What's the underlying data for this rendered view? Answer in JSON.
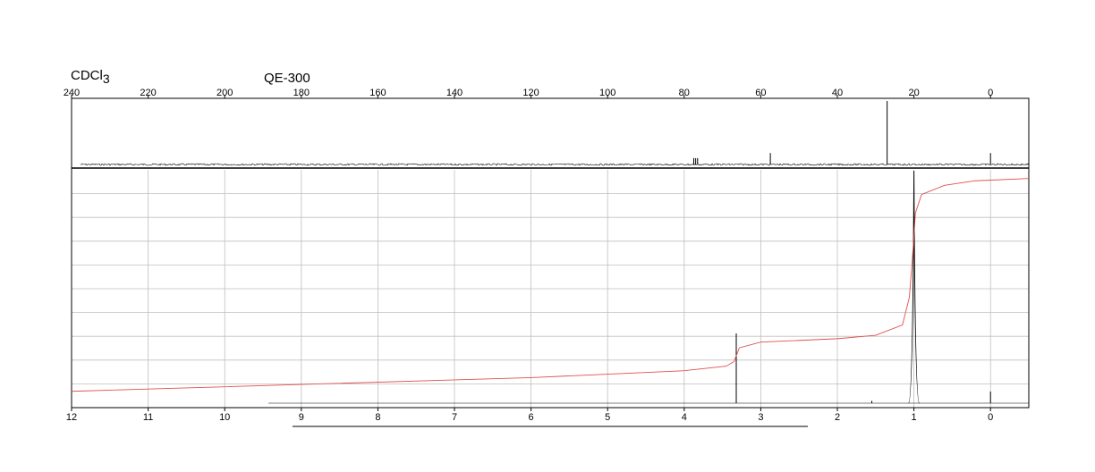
{
  "header": {
    "solvent_main": "CDCl",
    "solvent_sub": "3",
    "instrument": "QE-300"
  },
  "chart_data": [
    {
      "type": "line",
      "name": "13C spectrum",
      "xlim": [
        240,
        -10
      ],
      "x_reversed": true,
      "ticks": [
        240,
        220,
        200,
        180,
        160,
        140,
        120,
        100,
        80,
        60,
        40,
        20,
        0
      ],
      "tick_labels": [
        "240",
        "220",
        "200",
        "180",
        "160",
        "140",
        "120",
        "100",
        "80",
        "60",
        "40",
        "20",
        "0"
      ],
      "peaks": [
        {
          "x": 77.5,
          "h": 0.1
        },
        {
          "x": 77.0,
          "h": 0.1
        },
        {
          "x": 76.5,
          "h": 0.1
        },
        {
          "x": 57.5,
          "h": 0.18
        },
        {
          "x": 27.0,
          "h": 1.0
        },
        {
          "x": 0.0,
          "h": 0.18
        }
      ],
      "colors": {
        "trace": "#000000"
      }
    },
    {
      "type": "line",
      "name": "1H spectrum",
      "xlim": [
        12,
        -0.5
      ],
      "x_reversed": true,
      "ticks": [
        12,
        11,
        10,
        9,
        8,
        7,
        6,
        5,
        4,
        3,
        2,
        1,
        0
      ],
      "tick_labels": [
        "12",
        "11",
        "10",
        "9",
        "8",
        "7",
        "6",
        "5",
        "4",
        "3",
        "2",
        "1",
        "0"
      ],
      "peaks": [
        {
          "x": 3.32,
          "h": 0.3
        },
        {
          "x": 1.0,
          "h": 1.0
        },
        {
          "x": 1.55,
          "h": 0.01
        },
        {
          "x": 0.0,
          "h": 0.05
        }
      ],
      "integral": [
        [
          12,
          0.04
        ],
        [
          9,
          0.07
        ],
        [
          6,
          0.1
        ],
        [
          4,
          0.13
        ],
        [
          3.45,
          0.15
        ],
        [
          3.35,
          0.17
        ],
        [
          3.28,
          0.23
        ],
        [
          3.0,
          0.255
        ],
        [
          2.0,
          0.27
        ],
        [
          1.5,
          0.285
        ],
        [
          1.15,
          0.33
        ],
        [
          1.06,
          0.45
        ],
        [
          1.02,
          0.62
        ],
        [
          0.98,
          0.82
        ],
        [
          0.9,
          0.9
        ],
        [
          0.6,
          0.94
        ],
        [
          0.2,
          0.96
        ],
        [
          -0.5,
          0.97
        ]
      ],
      "colors": {
        "trace": "#000000",
        "integral": "#e05050",
        "grid": "#bfbfbf"
      }
    }
  ]
}
